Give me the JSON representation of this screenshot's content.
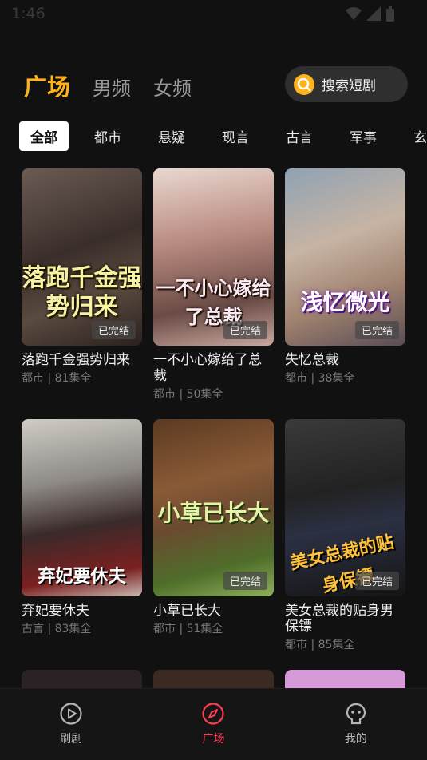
{
  "status_bar": {
    "time": "1:46"
  },
  "tabs": [
    {
      "label": "广场",
      "active": true
    },
    {
      "label": "男频",
      "active": false
    },
    {
      "label": "女频",
      "active": false
    }
  ],
  "search": {
    "label": "搜索短剧"
  },
  "categories": [
    {
      "label": "全部",
      "active": true
    },
    {
      "label": "都市"
    },
    {
      "label": "悬疑"
    },
    {
      "label": "现言"
    },
    {
      "label": "古言"
    },
    {
      "label": "军事"
    },
    {
      "label": "玄幻"
    }
  ],
  "dramas": [
    {
      "title": "落跑千金强势归来",
      "meta": "都市 | 81集全",
      "badge": "已完结",
      "poster_text": "落跑千金强势归来"
    },
    {
      "title": "一不小心嫁给了总裁",
      "meta": "都市 | 50集全",
      "badge": "已完结",
      "poster_text": "一不小心嫁给了总裁"
    },
    {
      "title": "失忆总裁",
      "meta": "都市 | 38集全",
      "badge": "已完结",
      "poster_text": "浅忆微光"
    },
    {
      "title": "弃妃要休夫",
      "meta": "古言 | 83集全",
      "badge": "",
      "poster_text": "弃妃要休夫"
    },
    {
      "title": "小草已长大",
      "meta": "都市 | 51集全",
      "badge": "已完结",
      "poster_text": "小草已长大"
    },
    {
      "title": "美女总裁的贴身男保镖",
      "meta": "都市 | 85集全",
      "badge": "已完结",
      "poster_text": "美女总裁的贴身保镖"
    }
  ],
  "bottom_nav": [
    {
      "label": "刷剧",
      "icon": "play-circle-icon",
      "active": false
    },
    {
      "label": "广场",
      "icon": "compass-icon",
      "active": true
    },
    {
      "label": "我的",
      "icon": "profile-icon",
      "active": false
    }
  ],
  "colors": {
    "accent": "#ffb21a",
    "nav_active": "#ff3b54",
    "background": "#111111"
  }
}
